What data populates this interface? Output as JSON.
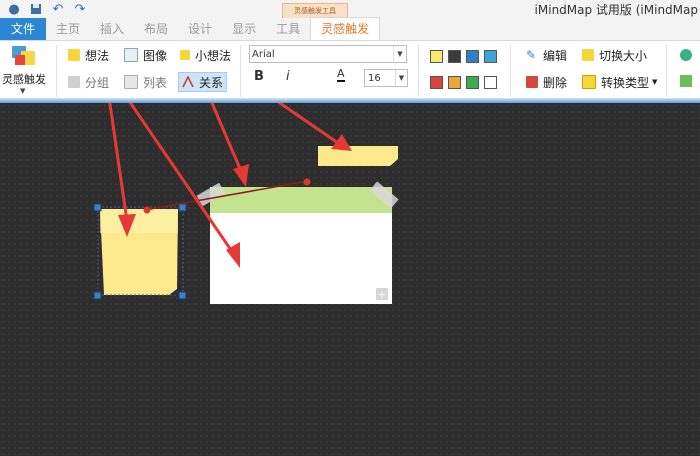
{
  "app": {
    "title": "iMindMap 试用版 (iMindMap"
  },
  "context_tab_label": "灵感触发工具",
  "tabs": [
    {
      "label": "文件"
    },
    {
      "label": "主页"
    },
    {
      "label": "插入"
    },
    {
      "label": "布局"
    },
    {
      "label": "设计"
    },
    {
      "label": "显示"
    },
    {
      "label": "工具"
    },
    {
      "label": "灵感触发"
    }
  ],
  "ribbon": {
    "big_button_label": "灵感触发",
    "insert": {
      "idea": "想法",
      "image": "图像",
      "small_idea": "小想法",
      "group": "分组",
      "list": "列表",
      "relation": "关系"
    },
    "font": {
      "family": "Arial",
      "size": "16",
      "bold": "B",
      "italic": "i",
      "color": "A"
    },
    "colors": [
      "#f7ea6e",
      "#3c3c3c",
      "#2f7fc6",
      "#3ea3d6",
      "#d9453b",
      "#efa43a",
      "#3cad4a",
      "#ffffff"
    ],
    "edit": {
      "edit": "编辑",
      "delete": "删除",
      "toggle_size": "切换大小",
      "convert_type": "转换类型"
    }
  },
  "canvas": {
    "note_plus": "+"
  }
}
